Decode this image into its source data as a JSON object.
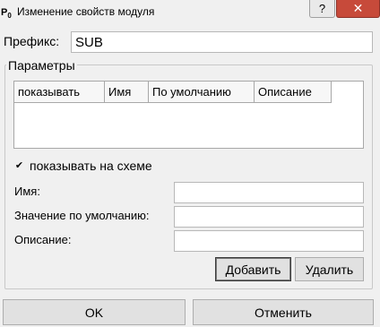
{
  "window": {
    "icon_glyph": "P",
    "icon_sub": "0",
    "title": "Изменение свойств модуля",
    "help_glyph": "?",
    "close_glyph": "✕"
  },
  "prefix": {
    "label": "Префикс:",
    "value": "SUB"
  },
  "params": {
    "group_title": "Параметры",
    "columns": [
      "показывать",
      "Имя",
      "По умолчанию",
      "Описание"
    ],
    "rows": []
  },
  "show_on_scheme": {
    "label": "показывать на схеме",
    "checked": true,
    "mark": "✔"
  },
  "form": {
    "name_label": "Имя:",
    "default_label": "Значение по умолчанию:",
    "description_label": "Описание:",
    "name_value": "",
    "default_value": "",
    "description_value": ""
  },
  "actions": {
    "add": "Добавить",
    "remove": "Удалить"
  },
  "footer": {
    "ok": "OK",
    "cancel": "Отменить"
  }
}
